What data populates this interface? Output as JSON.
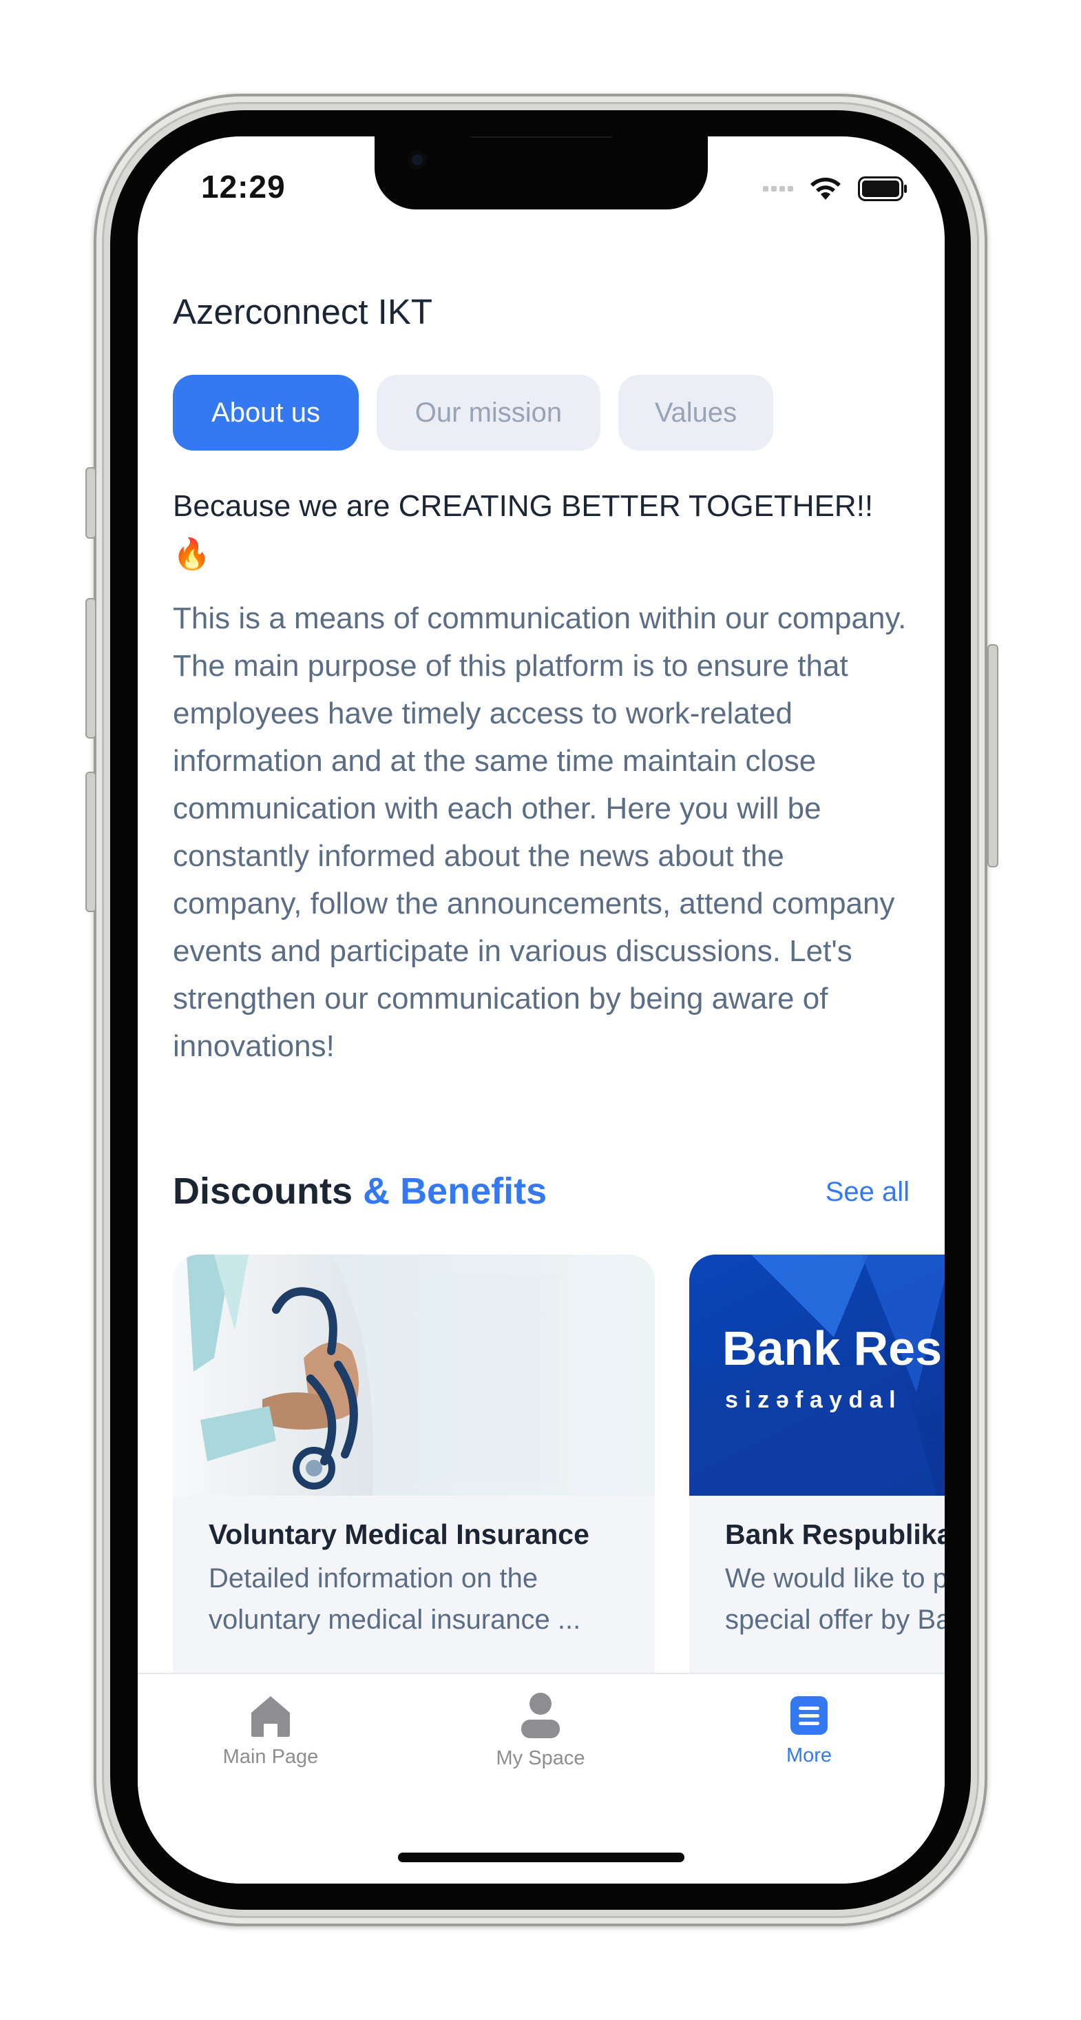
{
  "status_bar": {
    "time": "12:29"
  },
  "header": {
    "company_name": "Azerconnect IKT"
  },
  "tabs": [
    {
      "label": "About us",
      "active": true
    },
    {
      "label": "Our mission",
      "active": false
    },
    {
      "label": "Values",
      "active": false
    }
  ],
  "about": {
    "headline": "Because we are CREATING BETTER TOGETHER!!",
    "headline_emoji": "🔥",
    "body": "This is a means of communication within our company. The main purpose of this platform is to ensure that employees have timely access to work-related information and at the same time maintain close communication with each other. Here you will be constantly informed about the news about the company, follow the announcements, attend company events and participate in various discussions. Let's strengthen our communication by being aware of innovations!"
  },
  "discounts": {
    "title_part1": "Discounts",
    "title_part2": "& Benefits",
    "see_all": "See all",
    "cards": [
      {
        "title": "Voluntary Medical Insurance",
        "desc_line1": "Detailed information on the",
        "desc_line2": "voluntary medical insurance ...",
        "image": "doctor-with-stethoscope"
      },
      {
        "title": "Bank Respublika",
        "desc_line1": "We would like to p",
        "desc_line2": "special offer by Ba",
        "image_text_line1": "Bank Res",
        "image_text_line2": "s i z ə  f a y d a l"
      }
    ]
  },
  "bottom_nav": [
    {
      "label": "Main Page",
      "icon": "home-icon",
      "active": false
    },
    {
      "label": "My Space",
      "icon": "person-icon",
      "active": false
    },
    {
      "label": "More",
      "icon": "menu-icon",
      "active": true
    }
  ],
  "colors": {
    "accent": "#3479f1",
    "text_dark": "#1c2534",
    "text_body": "#5b6d85",
    "tab_inactive_bg": "#ebeef4"
  }
}
